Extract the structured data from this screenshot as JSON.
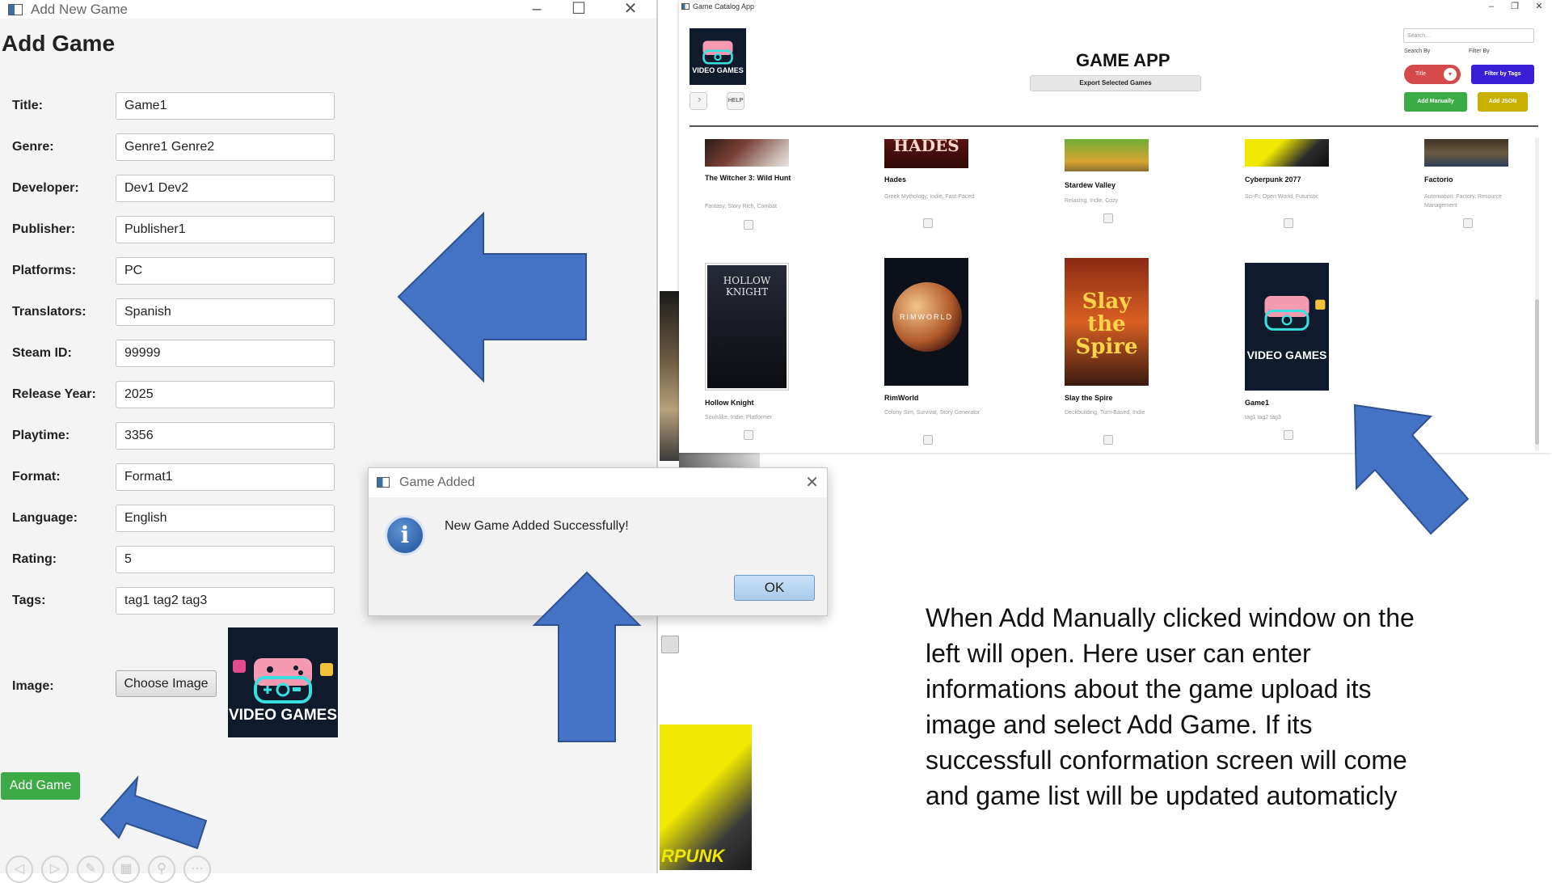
{
  "add_window": {
    "title": "Add New Game",
    "heading": "Add Game",
    "fields": [
      {
        "label": "Title:",
        "value": "Game1"
      },
      {
        "label": "Genre:",
        "value": "Genre1 Genre2"
      },
      {
        "label": "Developer:",
        "value": "Dev1 Dev2"
      },
      {
        "label": "Publisher:",
        "value": "Publisher1"
      },
      {
        "label": "Platforms:",
        "value": "PC"
      },
      {
        "label": "Translators:",
        "value": "Spanish"
      },
      {
        "label": "Steam ID:",
        "value": "99999"
      },
      {
        "label": "Release Year:",
        "value": "2025"
      },
      {
        "label": "Playtime:",
        "value": "3356"
      },
      {
        "label": "Format:",
        "value": "Format1"
      },
      {
        "label": "Language:",
        "value": "English"
      },
      {
        "label": "Rating:",
        "value": "5"
      },
      {
        "label": "Tags:",
        "value": "tag1 tag2 tag3"
      }
    ],
    "image_label": "Image:",
    "choose_image_label": "Choose Image",
    "add_game_label": "Add Game",
    "logo_text": "VIDEO GAMES"
  },
  "catalog": {
    "window_title": "Game Catalog App",
    "app_title": "GAME APP",
    "export_label": "Export Selected Games",
    "logo_text": "VIDEO GAMES",
    "help_label": "HELP",
    "search_placeholder": "Search...",
    "search_by_label": "Search By",
    "filter_by_label": "Filter By",
    "title_toggle_label": "Title",
    "filter_tags_label": "Filter by Tags",
    "add_manually_label": "Add Manually",
    "add_json_label": "Add JSON",
    "games": [
      {
        "name": "The Witcher 3: Wild Hunt",
        "tags": "Fantasy, Story Rich, Combat"
      },
      {
        "name": "Hades",
        "tags": "Greek Mythology, Indie, Fast-Paced",
        "cover_text": "HADES"
      },
      {
        "name": "Stardew Valley",
        "tags": "Relaxing, Indie, Cozy"
      },
      {
        "name": "Cyberpunk 2077",
        "tags": "Sci-Fi, Open World, Futuristic"
      },
      {
        "name": "Factorio",
        "tags": "Automation, Factory, Resource Management"
      },
      {
        "name": "Hollow Knight",
        "tags": "Soulslike, Indie, Platformer",
        "cover_text": "HOLLOW KNIGHT"
      },
      {
        "name": "RimWorld",
        "tags": "Colony Sim, Survival, Story Generator",
        "cover_text": "RIMWORLD"
      },
      {
        "name": "Slay the Spire",
        "tags": "Deckbuilding, Turn-Based, Indie",
        "cover_text": "Slay the Spire"
      },
      {
        "name": "Game1",
        "tags": "tag1 tag2 tag3",
        "cover_text": "VIDEO GAMES"
      }
    ]
  },
  "dialog": {
    "title": "Game Added",
    "message": "New Game Added Successfully!",
    "ok_label": "OK"
  },
  "background": {
    "cyberpunk_fragment_text": "RPUNK"
  },
  "description": "When Add Manually clicked window on the left will open. Here user can enter informations about the game upload its image and select Add Game. If its successfull conformation screen will come and game list will be updated automaticly",
  "colors": {
    "arrow_fill": "#4472c4",
    "add_game_green": "#3cab45",
    "toggle_red": "#d44a4a",
    "filter_blue": "#3a1fd6",
    "add_json_yellow": "#c8b000"
  }
}
